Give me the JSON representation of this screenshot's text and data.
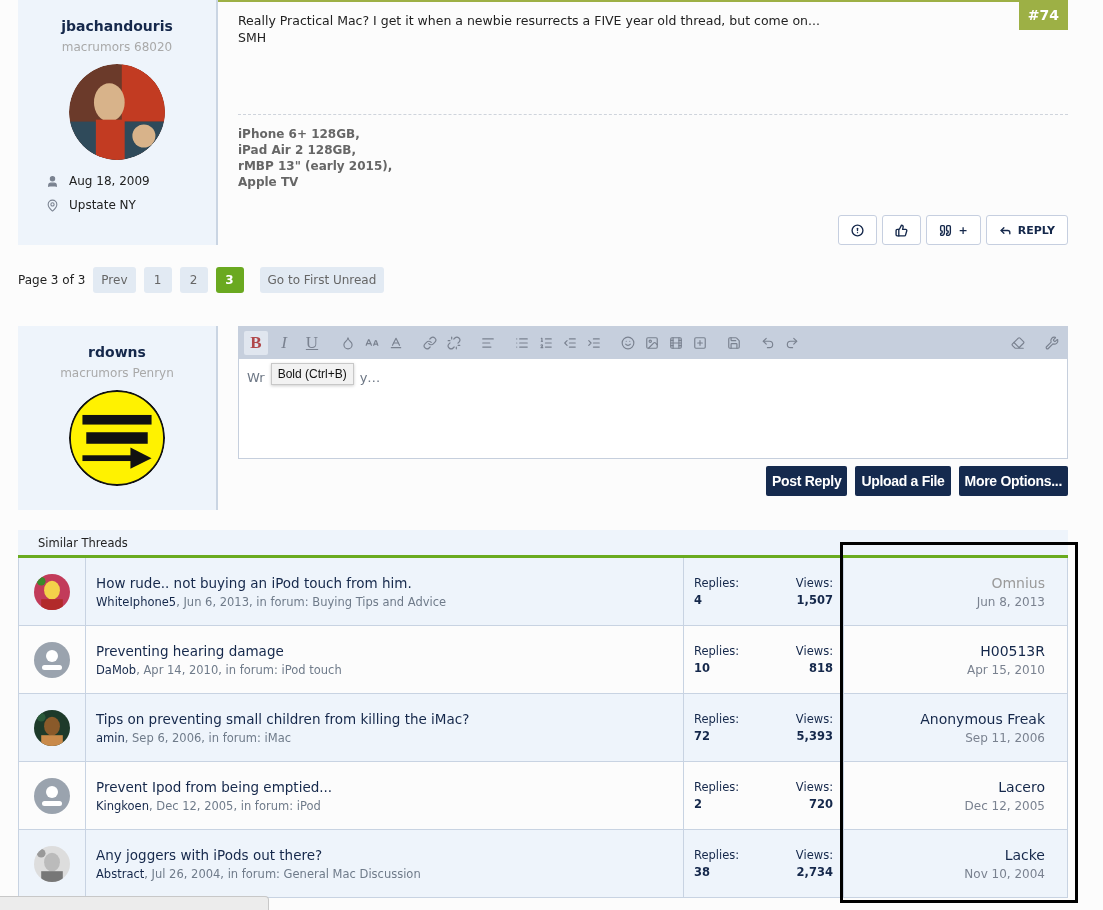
{
  "post": {
    "number": "#74",
    "author": {
      "name": "jbachandouris",
      "rank": "macrumors 68020",
      "joined": "Aug 18, 2009",
      "location": "Upstate NY"
    },
    "body": [
      "Really Practical Mac? I get it when a newbie resurrects a FIVE year old thread, but come on...",
      "SMH"
    ],
    "signature": [
      "iPhone 6+ 128GB,",
      "iPad Air 2 128GB,",
      "rMBP 13\" (early 2015),",
      "Apple TV"
    ],
    "actions": [
      {
        "kind": "report"
      },
      {
        "kind": "like"
      },
      {
        "kind": "quote",
        "label": "+"
      },
      {
        "kind": "reply",
        "label": "REPLY"
      }
    ]
  },
  "pagination": {
    "summary": "Page 3 of 3",
    "prev": "Prev",
    "pages": [
      {
        "label": "1",
        "selected": false
      },
      {
        "label": "2",
        "selected": false
      },
      {
        "label": "3",
        "selected": true
      }
    ],
    "first_unread": "Go to First Unread"
  },
  "reply_form": {
    "author": {
      "name": "rdowns",
      "rank": "macrumors Penryn",
      "avatar": {
        "kind": "badge"
      }
    },
    "format_buttons": [
      {
        "label": "B",
        "selected": true
      },
      {
        "label": "I",
        "selected": false
      },
      {
        "label": "U",
        "selected": false
      }
    ],
    "placeholder_visible": [
      "Wr",
      "y…"
    ],
    "tooltip": "Bold (Ctrl+B)",
    "buttons": [
      "Post Reply",
      "Upload a File",
      "More Options..."
    ]
  },
  "similar_threads": {
    "title": "Similar Threads",
    "rows": [
      {
        "default_avatar": false,
        "title": "How rude.. not buying an iPod touch from him.",
        "starter": "WhiteIphone5",
        "details": ", Jun 6, 2013, in forum: Buying Tips and Advice",
        "replies_label": "Replies:",
        "replies": "4",
        "views_label": "Views:",
        "views": "1,507",
        "last_poster": "Omnius",
        "last_poster_muted": true,
        "last_date": "Jun 8, 2013"
      },
      {
        "default_avatar": true,
        "title": "Preventing hearing damage",
        "starter": "DaMob",
        "details": ", Apr 14, 2010, in forum: iPod touch",
        "replies_label": "Replies:",
        "replies": "10",
        "views_label": "Views:",
        "views": "818",
        "last_poster": "H00513R",
        "last_poster_muted": false,
        "last_date": "Apr 15, 2010"
      },
      {
        "default_avatar": false,
        "title": "Tips on preventing small children from killing the iMac?",
        "starter": "amin",
        "details": ", Sep 6, 2006, in forum: iMac",
        "replies_label": "Replies:",
        "replies": "72",
        "views_label": "Views:",
        "views": "5,393",
        "last_poster": "Anonymous Freak",
        "last_poster_muted": false,
        "last_date": "Sep 11, 2006"
      },
      {
        "default_avatar": true,
        "title": "Prevent Ipod from being emptied...",
        "starter": "Kingkoen",
        "details": ", Dec 12, 2005, in forum: iPod",
        "replies_label": "Replies:",
        "replies": "2",
        "views_label": "Views:",
        "views": "720",
        "last_poster": "Lacero",
        "last_poster_muted": false,
        "last_date": "Dec 12, 2005"
      },
      {
        "default_avatar": false,
        "title": "Any joggers with iPods out there?",
        "starter": "Abstract",
        "details": ", Jul 26, 2004, in forum: General Mac Discussion",
        "replies_label": "Replies:",
        "replies": "38",
        "views_label": "Views:",
        "views": "2,734",
        "last_poster": "Lacke",
        "last_poster_muted": false,
        "last_date": "Nov 10, 2004"
      }
    ]
  }
}
